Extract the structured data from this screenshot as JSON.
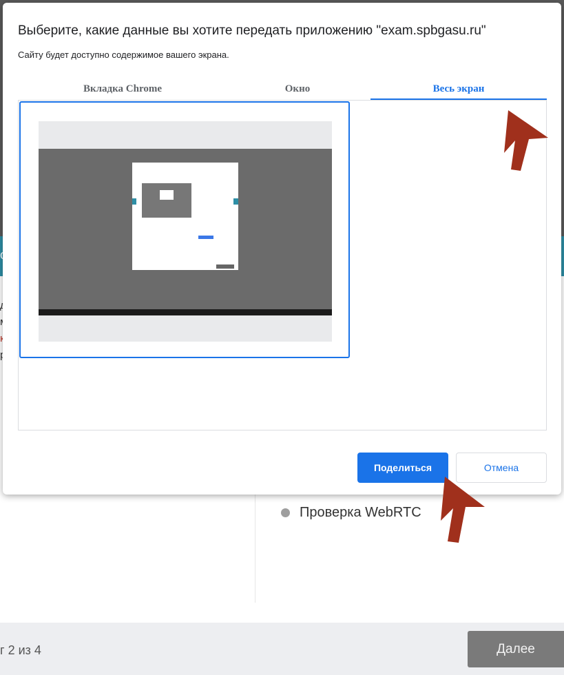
{
  "background": {
    "teal_letter": "o",
    "left_fragments": [
      "д",
      "м",
      "к",
      "р"
    ],
    "webrtc_item": "Проверка WebRTC",
    "step_label": "г 2 из 4",
    "next_button": "Далее"
  },
  "dialog": {
    "title": "Выберите, какие данные вы хотите передать приложению \"exam.spbgasu.ru\"",
    "subtitle": "Сайту будет доступно содержимое вашего экрана.",
    "tabs": [
      {
        "label": "Вкладка Chrome",
        "selected": false
      },
      {
        "label": "Окно",
        "selected": false
      },
      {
        "label": "Весь экран",
        "selected": true
      }
    ],
    "share_button": "Поделиться",
    "cancel_button": "Отмена"
  },
  "colors": {
    "accent": "#1a73e8",
    "arrow": "#a0301c",
    "teal": "#2e8fa6"
  }
}
